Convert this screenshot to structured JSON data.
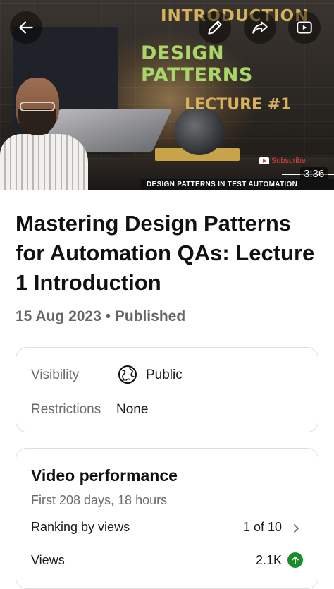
{
  "thumbnail": {
    "heading_line1": "INTRODUCTION",
    "heading_line2": "DESIGN PATTERNS",
    "heading_line3": "LECTURE #1",
    "subscribe_label": "Subscribe",
    "caption": "DESIGN PATTERNS IN TEST AUTOMATION",
    "duration": "3:36"
  },
  "toolbar": {
    "back_icon": "arrow-left-icon",
    "edit_icon": "pencil-icon",
    "share_icon": "share-icon",
    "youtube_icon": "youtube-icon"
  },
  "video": {
    "title": "Mastering Design Patterns for Automation QAs: Lecture 1 Introduction",
    "meta": "15 Aug 2023 • Published"
  },
  "details": {
    "visibility_label": "Visibility",
    "visibility_value": "Public",
    "restrictions_label": "Restrictions",
    "restrictions_value": "None"
  },
  "performance": {
    "title": "Video performance",
    "subtitle": "First 208 days, 18 hours",
    "ranking_label": "Ranking by views",
    "ranking_value": "1 of 10",
    "views_label": "Views",
    "views_value": "2.1K"
  },
  "colors": {
    "accent_green": "#1a8d2b",
    "subscribe_red": "#e04040"
  }
}
